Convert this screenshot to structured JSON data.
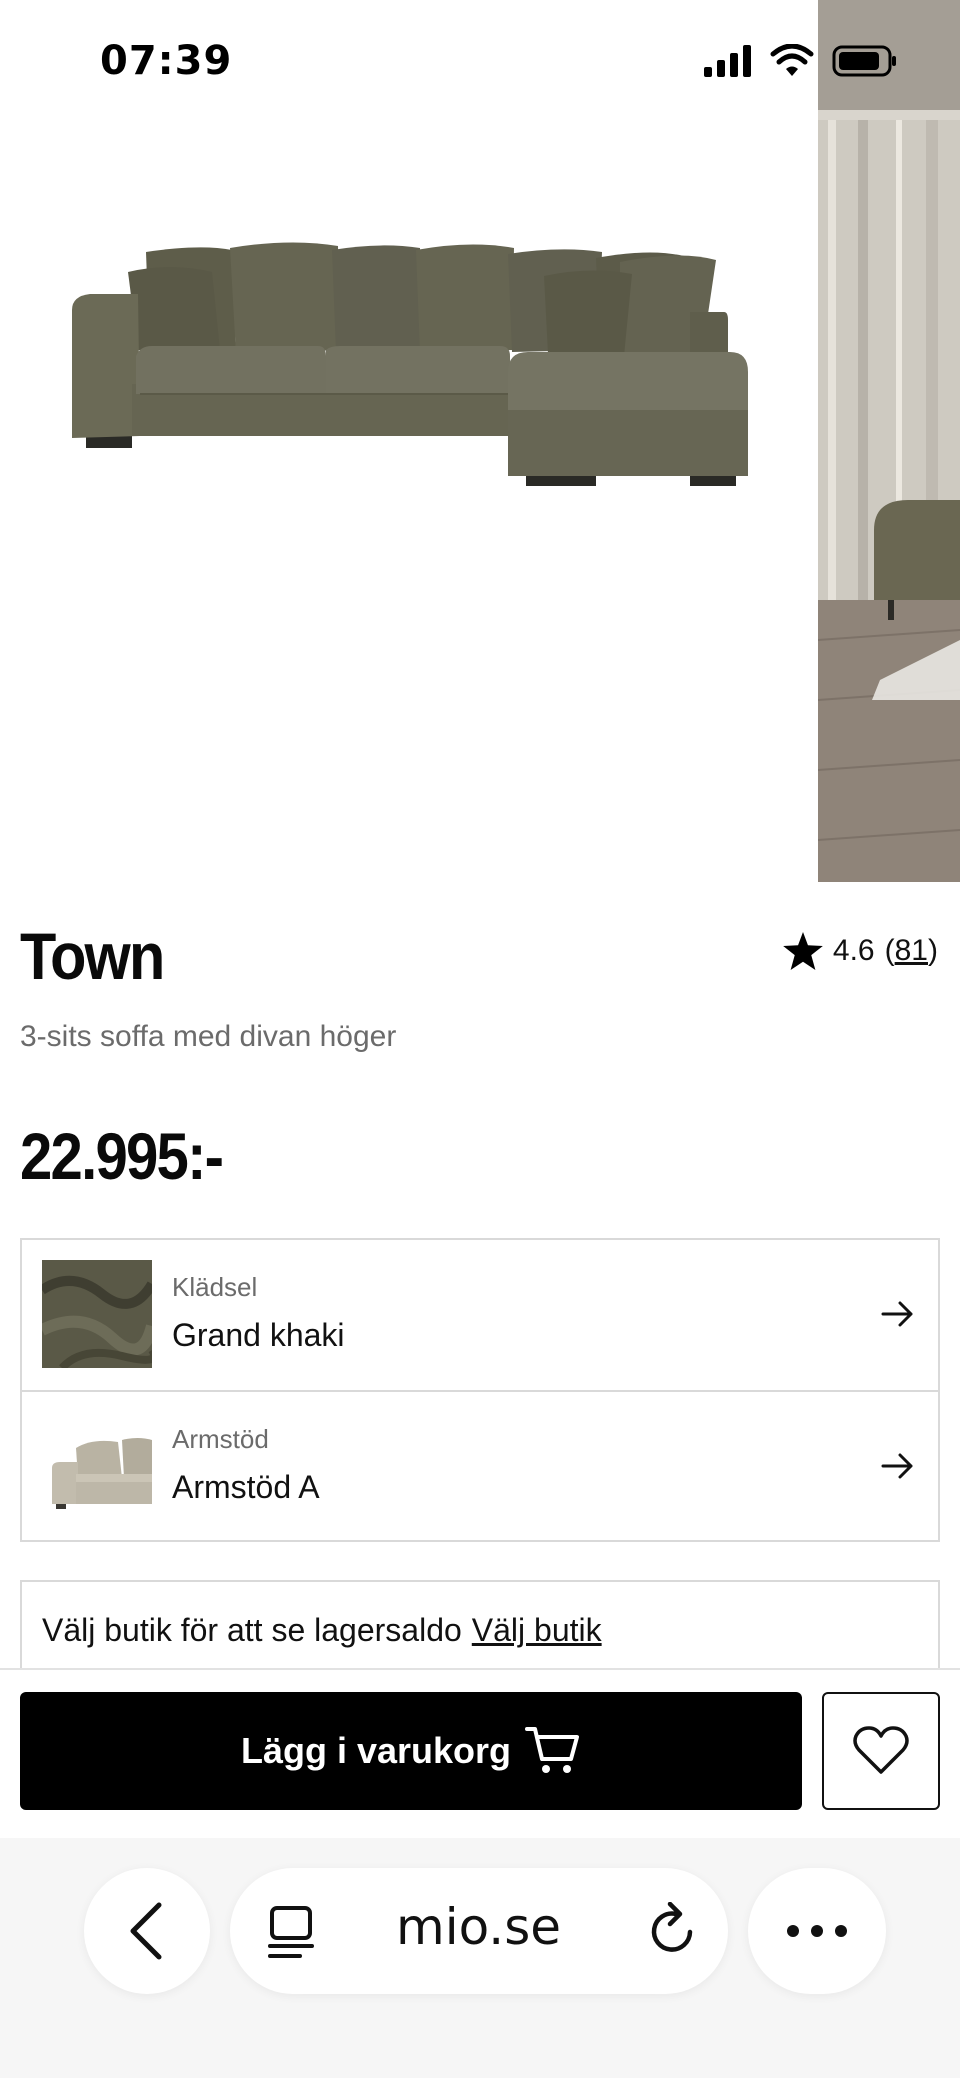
{
  "status": {
    "time": "07:39"
  },
  "product": {
    "title": "Town",
    "subtitle": "3-sits soffa med divan höger",
    "price": "22.995:-",
    "rating": "4.6",
    "rating_count_open": "(",
    "rating_count": "81",
    "rating_count_close": ")"
  },
  "options": [
    {
      "label": "Klädsel",
      "value": "Grand khaki"
    },
    {
      "label": "Armstöd",
      "value": "Armstöd A"
    }
  ],
  "store": {
    "text": "Välj butik för att se lagersaldo",
    "link": "Välj butik"
  },
  "actions": {
    "add_to_cart": "Lägg i varukorg"
  },
  "browser": {
    "url": "mio.se"
  },
  "colors": {
    "sofa": "#6b6a56",
    "sofa_dark": "#5a5947",
    "primary": "#000000"
  },
  "icons": [
    "signal-icon",
    "wifi-icon",
    "battery-icon",
    "star-icon",
    "arrow-right-icon",
    "cart-icon",
    "heart-icon",
    "back-icon",
    "reader-icon",
    "reload-icon",
    "more-icon"
  ]
}
